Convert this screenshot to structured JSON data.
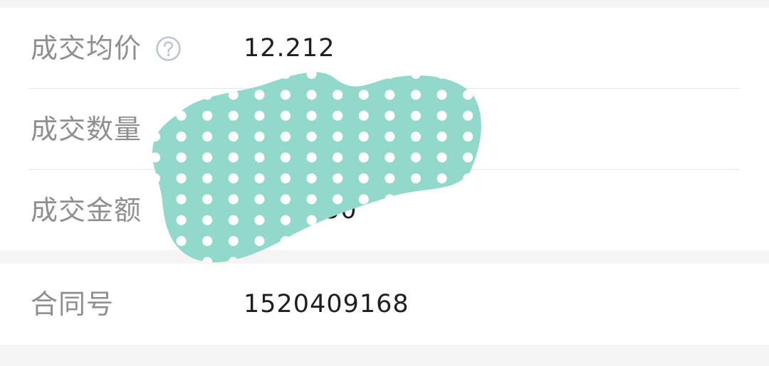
{
  "trade": {
    "avg_price_label": "成交均价",
    "avg_price_value": "12.212",
    "quantity_label": "成交数量",
    "amount_label": "成交金额",
    "amount_value_tail": "50"
  },
  "contract": {
    "label": "合同号",
    "value": "1520409168"
  },
  "icons": {
    "help": "question-circle-icon"
  },
  "colors": {
    "redaction_fill": "#92d9cc",
    "redaction_dots": "#ffffff"
  }
}
